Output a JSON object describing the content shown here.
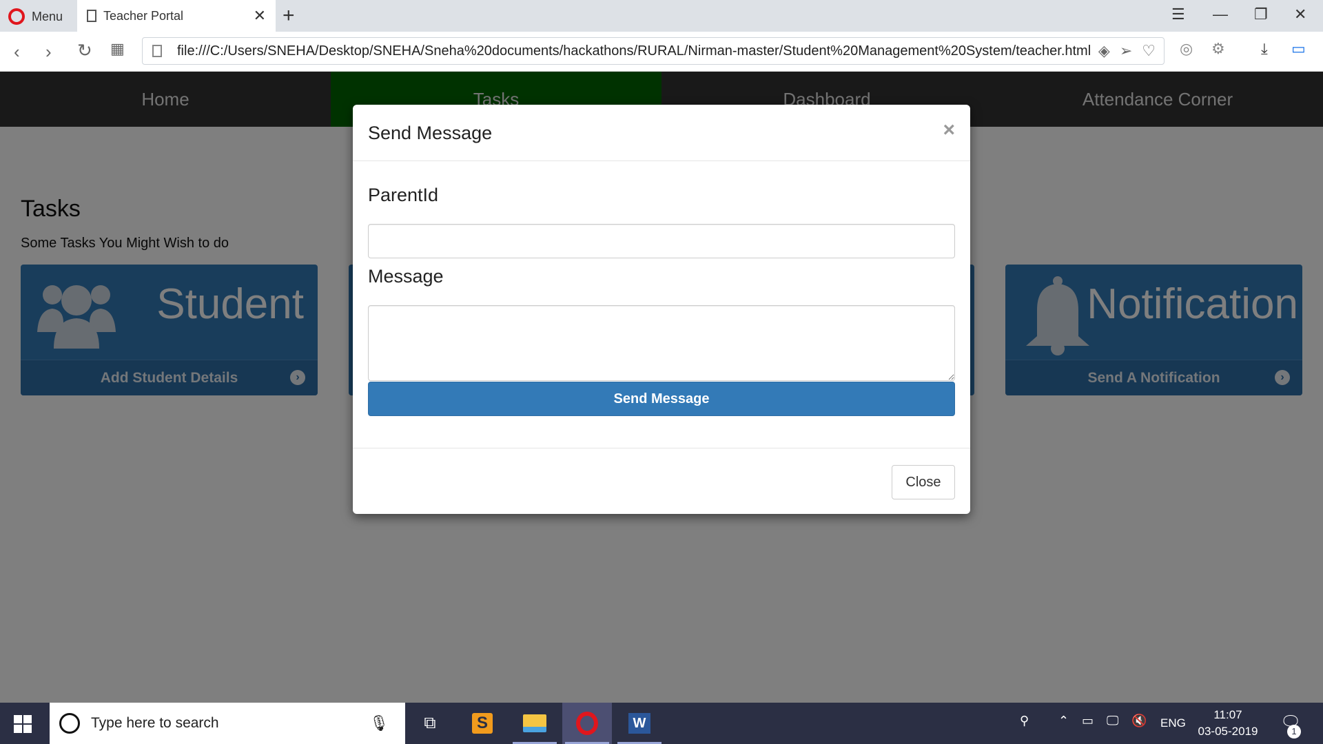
{
  "browser": {
    "menu_label": "Menu",
    "tab_title": "Teacher Portal",
    "url": "file:///C:/Users/SNEHA/Desktop/SNEHA/Sneha%20documents/hackathons/RURAL/Nirman-master/Student%20Management%20System/teacher.html"
  },
  "nav": {
    "items": [
      {
        "label": "Home"
      },
      {
        "label": "Tasks"
      },
      {
        "label": "Dashboard"
      },
      {
        "label": "Attendance Corner"
      }
    ],
    "active_index": 1,
    "active_color": "#006400",
    "bg_color": "#333333"
  },
  "main": {
    "title": "Tasks",
    "subtitle": "Some Tasks You Might Wish to do",
    "cards": [
      {
        "title": "Student",
        "action": "Add Student Details",
        "icon": "users-icon"
      },
      {
        "title": "Notification",
        "action": "Send A Notification",
        "icon": "bell-icon"
      }
    ],
    "card_color": "#337ab7"
  },
  "modal": {
    "title": "Send Message",
    "close_symbol": "×",
    "parent_label": "ParentId",
    "parent_value": "",
    "message_label": "Message",
    "message_value": "",
    "submit_label": "Send Message",
    "close_label": "Close"
  },
  "taskbar": {
    "search_placeholder": "Type here to search",
    "lang": "ENG",
    "time": "11:07",
    "date": "03-05-2019",
    "notification_count": "1"
  }
}
